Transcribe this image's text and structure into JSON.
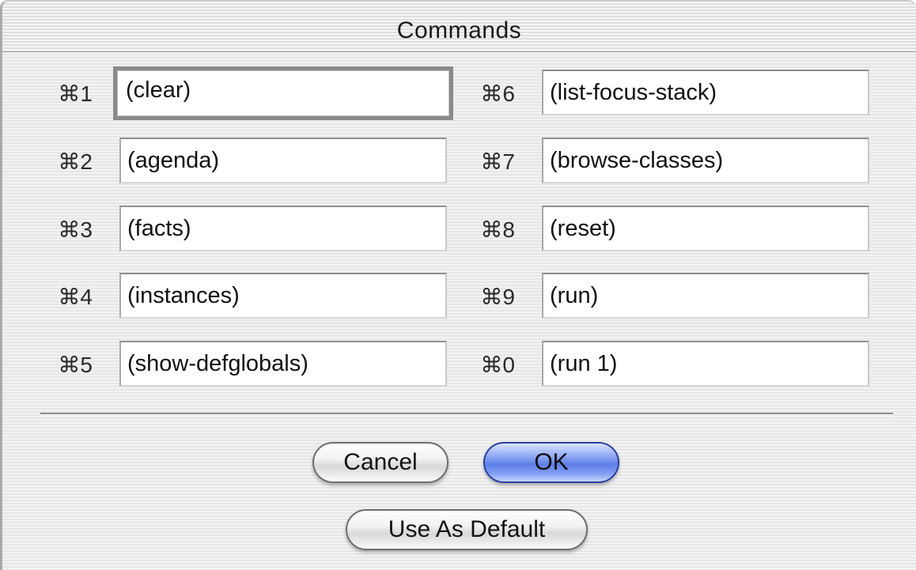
{
  "window": {
    "title": "Commands"
  },
  "commands": {
    "left": [
      {
        "shortcut": "⌘1",
        "value": "(clear)"
      },
      {
        "shortcut": "⌘2",
        "value": "(agenda)"
      },
      {
        "shortcut": "⌘3",
        "value": "(facts)"
      },
      {
        "shortcut": "⌘4",
        "value": "(instances)"
      },
      {
        "shortcut": "⌘5",
        "value": "(show-defglobals)"
      }
    ],
    "right": [
      {
        "shortcut": "⌘6",
        "value": "(list-focus-stack)"
      },
      {
        "shortcut": "⌘7",
        "value": "(browse-classes)"
      },
      {
        "shortcut": "⌘8",
        "value": "(reset)"
      },
      {
        "shortcut": "⌘9",
        "value": "(run)"
      },
      {
        "shortcut": "⌘0",
        "value": "(run 1)"
      }
    ]
  },
  "buttons": {
    "cancel": "Cancel",
    "ok": "OK",
    "use_as_default": "Use As Default"
  },
  "colors": {
    "default_button": "#5e7fe6",
    "focus_ring": "#8a8a8a"
  }
}
